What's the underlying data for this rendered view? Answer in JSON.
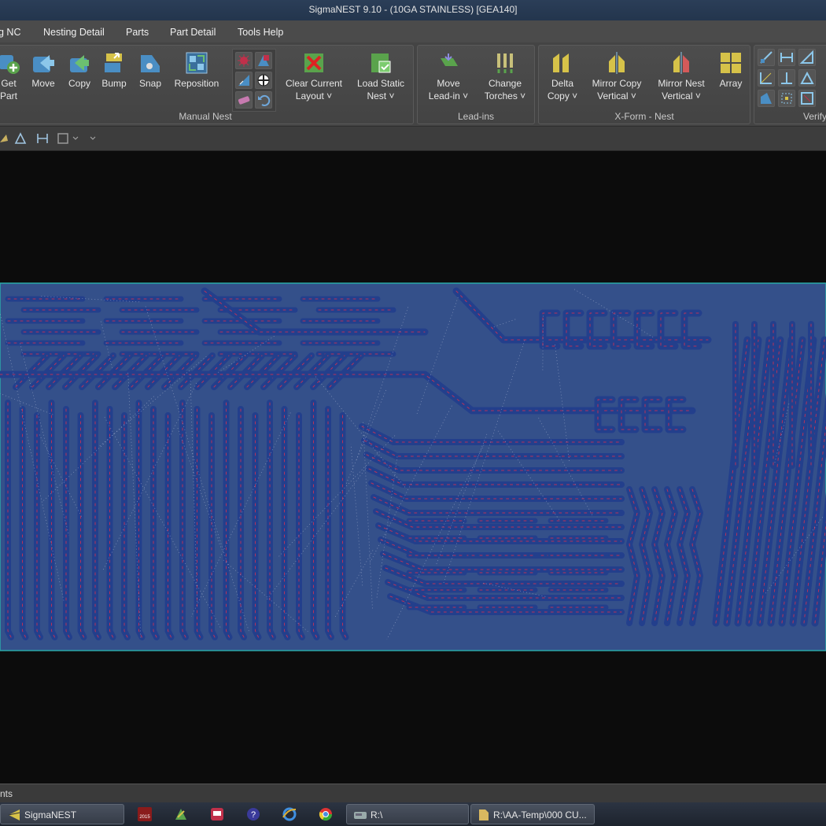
{
  "window": {
    "title": "SigmaNEST 9.10 -    (10GA STAINLESS) [GEA140]"
  },
  "menu": {
    "items": [
      "g NC",
      "Nesting Detail",
      "Parts",
      "Part Detail",
      "Tools Help"
    ]
  },
  "ribbon": {
    "manual_nest": {
      "label": "Manual Nest",
      "get_part": [
        "Get",
        "Part"
      ],
      "move": "Move",
      "copy": "Copy",
      "bump": "Bump",
      "snap": "Snap",
      "reposition": "Reposition",
      "clear_current_layout": [
        "Clear Current",
        "Layout"
      ],
      "load_static_nest": [
        "Load Static",
        "Nest"
      ]
    },
    "lead_ins": {
      "label": "Lead-ins",
      "move_lead_in": [
        "Move",
        "Lead-in"
      ],
      "change_torches": [
        "Change",
        "Torches"
      ]
    },
    "xform_nest": {
      "label": "X-Form - Nest",
      "delta_copy": [
        "Delta",
        "Copy"
      ],
      "mirror_copy_vertical": [
        "Mirror Copy",
        "Vertical"
      ],
      "mirror_nest_vertical": [
        "Mirror Nest",
        "Vertical"
      ],
      "array": "Array"
    },
    "verify": {
      "label": "Verify"
    }
  },
  "status": {
    "text": "nts"
  },
  "taskbar": {
    "sigmanest": "SigmaNEST",
    "explorer_r": "R:\\",
    "explorer_temp": "R:\\AA-Temp\\000 CU...",
    "year_badge": "2015"
  },
  "colors": {
    "plate": "#34508a",
    "part": "#233f8c",
    "lead": "#b5325a",
    "cut_path": "#c0c8e0",
    "ribbon_icon_yellow": "#d6c249",
    "ribbon_icon_blue": "#4a8ec4",
    "ribbon_icon_green": "#5aa34c"
  },
  "icons": [
    "get-part-icon",
    "move-icon",
    "copy-icon",
    "bump-icon",
    "snap-icon",
    "reposition-icon",
    "clear-layout-icon",
    "load-static-nest-icon",
    "move-lead-in-icon",
    "change-torches-icon",
    "delta-copy-icon",
    "mirror-copy-icon",
    "mirror-nest-icon",
    "array-icon"
  ]
}
